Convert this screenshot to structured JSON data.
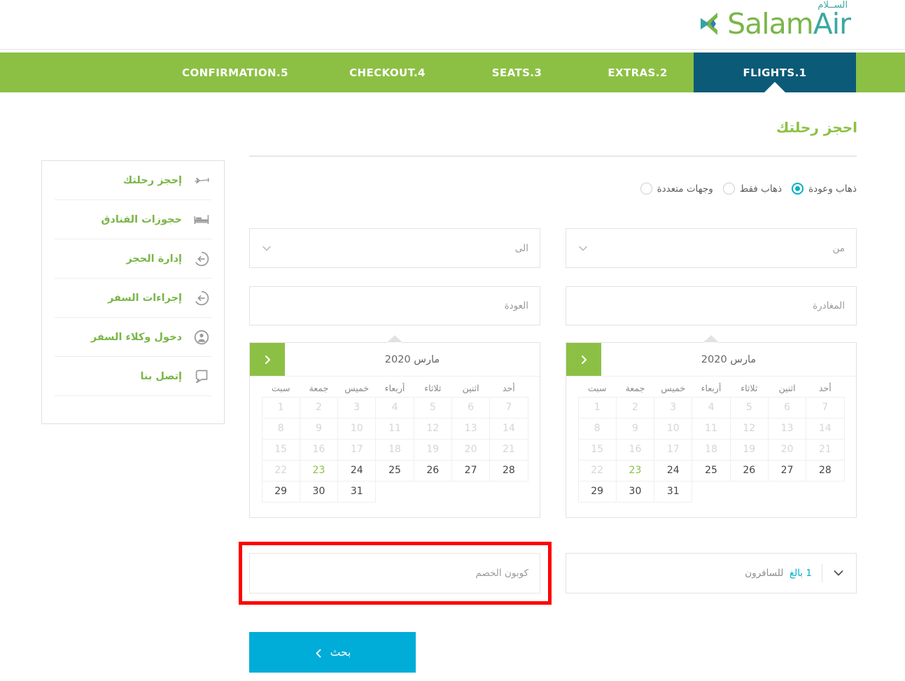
{
  "brand": {
    "logo_salam": "Salam",
    "logo_air": "Air",
    "logo_arabic": "الســلام",
    "color_green": "#8cc044",
    "color_teal": "#3aa8a0",
    "color_cyan": "#00add8",
    "color_active_tab": "#0b5a77",
    "color_highlight": "#ff0000"
  },
  "tabs": [
    {
      "label": "FLIGHTS.1",
      "active": true
    },
    {
      "label": "EXTRAS.2",
      "active": false
    },
    {
      "label": "SEATS.3",
      "active": false
    },
    {
      "label": "CHECKOUT.4",
      "active": false
    },
    {
      "label": "CONFIRMATION.5",
      "active": false
    }
  ],
  "page_title": "احجز رحلتك",
  "sidebar": {
    "items": [
      {
        "label": "إحجز رحلتك",
        "icon": "plane-icon"
      },
      {
        "label": "حجوزات الفنادق",
        "icon": "bed-icon"
      },
      {
        "label": "إدارة الحجز",
        "icon": "manage-booking-icon"
      },
      {
        "label": "إجراءات السفر",
        "icon": "check-in-icon"
      },
      {
        "label": "دخول وكلاء السفر",
        "icon": "agent-login-icon"
      },
      {
        "label": "إتصل بنا",
        "icon": "contact-icon"
      }
    ]
  },
  "trip_types": [
    {
      "label": "ذهاب وعودة",
      "selected": true
    },
    {
      "label": "ذهاب فقط",
      "selected": false
    },
    {
      "label": "وجهات متعددة",
      "selected": false
    }
  ],
  "fields": {
    "from_placeholder": "من",
    "to_placeholder": "الى",
    "departure_placeholder": "المغادرة",
    "return_placeholder": "العودة",
    "coupon_placeholder": "كوبون الخصم",
    "passengers_label": "للسافرون",
    "passengers_value": "1 بالغ",
    "from_value": "",
    "to_value": "",
    "departure_value": "",
    "return_value": "",
    "coupon_value": ""
  },
  "calendar": {
    "month_title": "مارس 2020",
    "day_names": [
      "أحد",
      "اثنين",
      "ثلاثاء",
      "أربعاء",
      "خميس",
      "جمعة",
      "سبت"
    ],
    "weeks": [
      [
        {
          "d": "1",
          "state": "dim"
        },
        {
          "d": "2",
          "state": "dim"
        },
        {
          "d": "3",
          "state": "dim"
        },
        {
          "d": "4",
          "state": "dim"
        },
        {
          "d": "5",
          "state": "dim"
        },
        {
          "d": "6",
          "state": "dim"
        },
        {
          "d": "7",
          "state": "dim"
        }
      ],
      [
        {
          "d": "8",
          "state": "dim"
        },
        {
          "d": "9",
          "state": "dim"
        },
        {
          "d": "10",
          "state": "dim"
        },
        {
          "d": "11",
          "state": "dim"
        },
        {
          "d": "12",
          "state": "dim"
        },
        {
          "d": "13",
          "state": "dim"
        },
        {
          "d": "14",
          "state": "dim"
        }
      ],
      [
        {
          "d": "15",
          "state": "dim"
        },
        {
          "d": "16",
          "state": "dim"
        },
        {
          "d": "17",
          "state": "dim"
        },
        {
          "d": "18",
          "state": "dim"
        },
        {
          "d": "19",
          "state": "dim"
        },
        {
          "d": "20",
          "state": "dim"
        },
        {
          "d": "21",
          "state": "dim"
        }
      ],
      [
        {
          "d": "22",
          "state": "dim"
        },
        {
          "d": "23",
          "state": "today"
        },
        {
          "d": "24",
          "state": "on"
        },
        {
          "d": "25",
          "state": "on"
        },
        {
          "d": "26",
          "state": "on"
        },
        {
          "d": "27",
          "state": "on"
        },
        {
          "d": "28",
          "state": "on"
        }
      ],
      [
        {
          "d": "29",
          "state": "on"
        },
        {
          "d": "30",
          "state": "on"
        },
        {
          "d": "31",
          "state": "on"
        },
        {
          "d": "",
          "state": "empty"
        },
        {
          "d": "",
          "state": "empty"
        },
        {
          "d": "",
          "state": "empty"
        },
        {
          "d": "",
          "state": "empty"
        }
      ]
    ],
    "next_icon": "chevron-right-icon"
  },
  "search_button": {
    "label": "بحث",
    "icon": "chevron-left-icon"
  }
}
